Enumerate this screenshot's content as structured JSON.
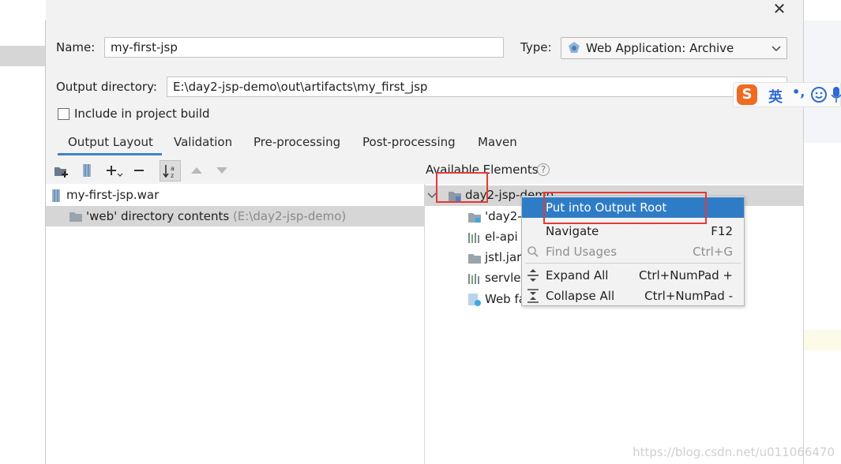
{
  "dialog": {
    "close_glyph": "✕",
    "name_label": "Name:",
    "name_value": "my-first-jsp",
    "type_label": "Type:",
    "type_value": "Web Application: Archive",
    "output_dir_label": "Output directory:",
    "output_dir_value": "E:\\day2-jsp-demo\\out\\artifacts\\my_first_jsp",
    "include_label": "Include in project build",
    "tabs": [
      {
        "label": "Output Layout",
        "active": true
      },
      {
        "label": "Validation"
      },
      {
        "label": "Pre-processing"
      },
      {
        "label": "Post-processing"
      },
      {
        "label": "Maven"
      }
    ],
    "available_elements_label": "Available Elements",
    "help_glyph": "?"
  },
  "left_tree": [
    {
      "label": "my-first-jsp.war",
      "icon": "war-archive-icon"
    },
    {
      "label": "'web' directory contents",
      "suffix": "(E:\\day2-jsp-demo)",
      "icon": "folder-icon",
      "selected": true
    }
  ],
  "right_tree": {
    "root": {
      "label": "day2-jsp-demo",
      "icon": "module-folder-icon"
    },
    "children": [
      {
        "label": "'day2-",
        "icon": "module-output-icon"
      },
      {
        "label": "el-api",
        "icon": "library-icon"
      },
      {
        "label": "jstl.jar",
        "icon": "jar-folder-icon"
      },
      {
        "label": "servlet",
        "icon": "library-icon"
      },
      {
        "label": "Web fa",
        "icon": "web-facet-icon"
      }
    ]
  },
  "context_menu": [
    {
      "label": "Put into Output Root",
      "shortcut": "",
      "highlighted": true
    },
    {
      "label": "Navigate",
      "shortcut": "F12"
    },
    {
      "label": "Find Usages",
      "shortcut": "Ctrl+G",
      "disabled": true,
      "icon": "search-icon"
    },
    {
      "label": "Expand All",
      "shortcut": "Ctrl+NumPad +",
      "icon": "expand-all-icon"
    },
    {
      "label": "Collapse All",
      "shortcut": "Ctrl+NumPad -",
      "icon": "collapse-all-icon"
    }
  ],
  "ime": {
    "logo": "S",
    "mode": "英",
    "punct": "•,"
  },
  "watermark": "https://blog.csdn.net/u011066470",
  "colors": {
    "accent": "#4083c9",
    "highlight": "#2f7cc6",
    "red_box": "#e53935",
    "ime_orange": "#f06a22"
  }
}
